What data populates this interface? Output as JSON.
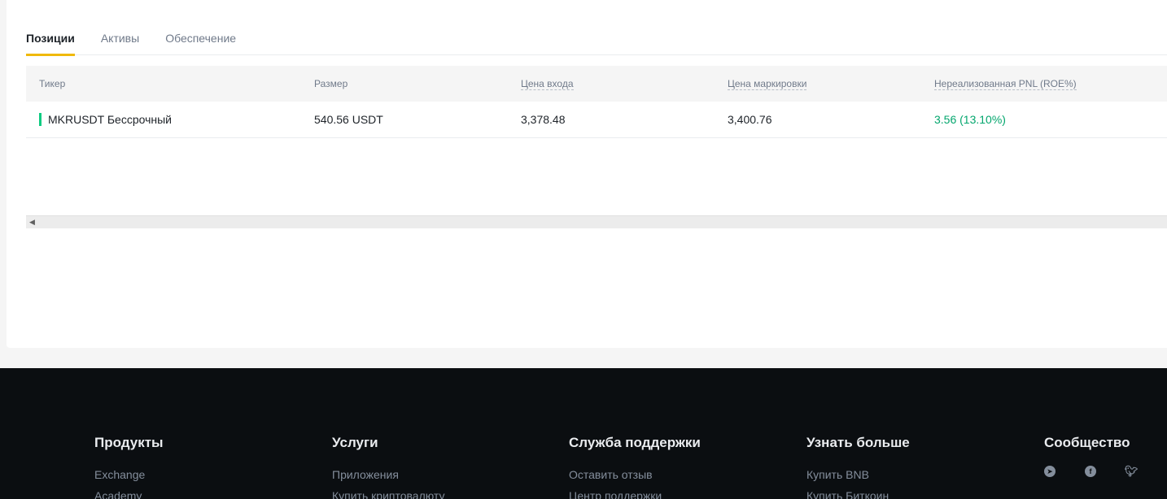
{
  "tabs": [
    {
      "label": "Позиции",
      "active": true
    },
    {
      "label": "Активы",
      "active": false
    },
    {
      "label": "Обеспечение",
      "active": false
    }
  ],
  "table": {
    "headers": [
      "Тикер",
      "Размер",
      "Цена входа",
      "Цена маркировки",
      "Нереализованная PNL (ROE%)"
    ],
    "rows": [
      {
        "ticker": "MKRUSDT Бессрочный",
        "size": "540.56 USDT",
        "entry_price": "3,378.48",
        "mark_price": "3,400.76",
        "pnl": "3.56 (13.10%)"
      }
    ]
  },
  "footer": {
    "columns": [
      {
        "title": "Продукты",
        "links": [
          "Exchange",
          "Academy"
        ]
      },
      {
        "title": "Услуги",
        "links": [
          "Приложения",
          "Купить криптовалюту"
        ]
      },
      {
        "title": "Служба поддержки",
        "links": [
          "Оставить отзыв",
          "Центр поддержки"
        ]
      },
      {
        "title": "Узнать больше",
        "links": [
          "Купить BNB",
          "Купить Биткоин"
        ]
      },
      {
        "title": "Сообщество",
        "icons": [
          "telegram-icon",
          "facebook-icon",
          "twitter-icon"
        ]
      }
    ]
  },
  "colors": {
    "accent": "#f0b90b",
    "positive": "#03a66d",
    "footer_bg": "#0b0e11"
  }
}
